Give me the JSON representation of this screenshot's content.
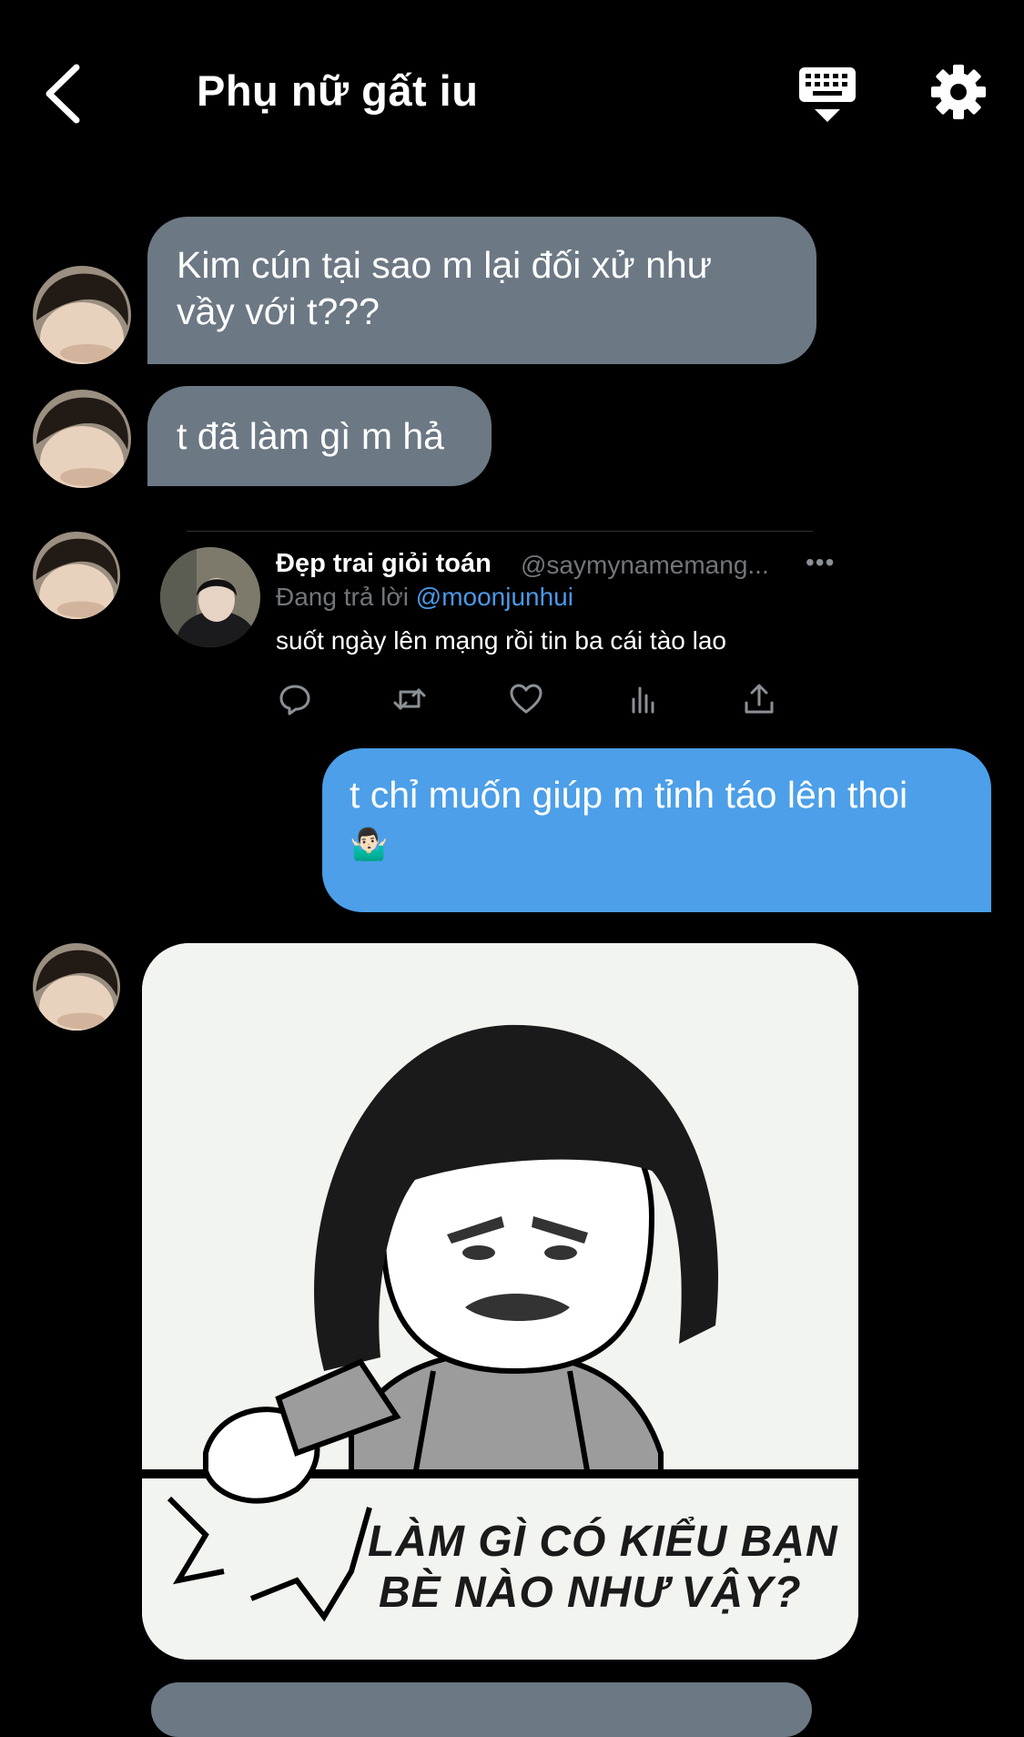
{
  "header": {
    "title": "Phụ nữ gất iu",
    "icons": {
      "back": "chevron-left-icon",
      "keyboard": "keyboard-icon",
      "settings": "gear-icon"
    }
  },
  "messages": [
    {
      "type": "text",
      "direction": "incoming",
      "lines": [
        "Kim cún tại sao m lại đối xử như",
        "vầy với t???"
      ]
    },
    {
      "type": "text",
      "direction": "incoming",
      "lines": [
        "t đã làm gì m hả"
      ]
    },
    {
      "type": "tweet",
      "direction": "incoming",
      "tweet": {
        "author_name": "Đẹp trai giỏi toán",
        "author_handle": "@saymynamemang...",
        "reply_prefix": "Đang trả lời",
        "reply_to": "@moonjunhui",
        "text": "suốt ngày lên mạng rồi tin ba cái tào lao",
        "more": "•••",
        "actions": [
          "reply-icon",
          "retweet-icon",
          "like-icon",
          "analytics-icon",
          "share-icon"
        ]
      }
    },
    {
      "type": "text",
      "direction": "outgoing",
      "lines": [
        "t chỉ muốn giúp m tỉnh táo lên thoi",
        "🤷🏻‍♂️"
      ]
    },
    {
      "type": "image",
      "direction": "incoming",
      "caption_lines": [
        "LÀM GÌ CÓ KIỂU BẠN",
        "BÈ NÀO NHƯ VẬY?"
      ]
    }
  ],
  "colors": {
    "background": "#000000",
    "incoming_bubble": "#6c7884",
    "outgoing_bubble": "#4c9fe8",
    "link": "#4a99e9",
    "muted_text": "#71767b"
  }
}
